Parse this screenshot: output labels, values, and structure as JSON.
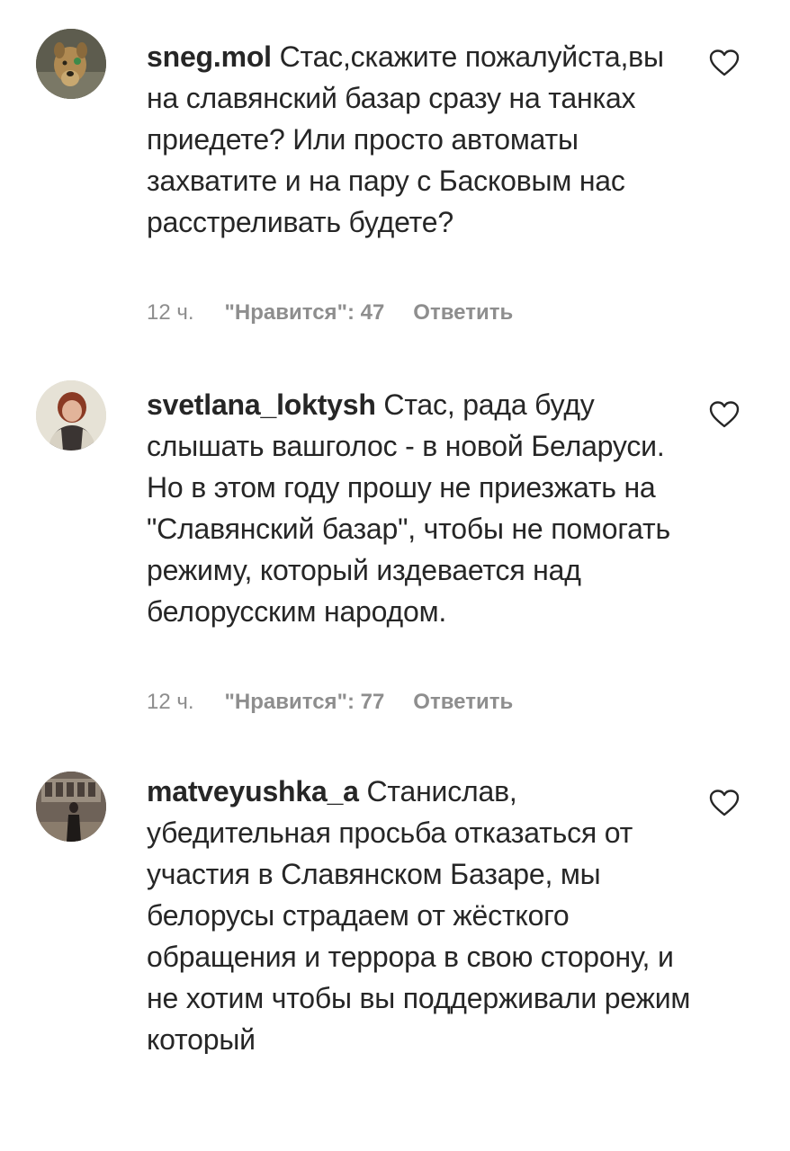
{
  "comments": [
    {
      "username": "sneg.mol",
      "text": "Стас,скажите пожалуйста,вы на славянский базар сразу на танках приедете? Или просто автоматы захватите и на пару с Басковым нас расстреливать будете?",
      "time": "12 ч.",
      "likes": "\"Нравится\": 47",
      "reply": "Ответить",
      "avatar_icon": "dog-photo-avatar"
    },
    {
      "username": "svetlana_loktysh",
      "text": "Стас, рада буду слышать вашголос - в новой Беларуси. Но в этом году прошу не приезжать на \"Славянский базар\", чтобы не помогать режиму, который издевается над белорусским народом.",
      "time": "12 ч.",
      "likes": "\"Нравится\": 77",
      "reply": "Ответить",
      "avatar_icon": "woman-photo-avatar"
    },
    {
      "username": "matveyushka_a",
      "text": "Станислав, убедительная просьба отказаться от участия в Славянском Базаре, мы белорусы страдаем от жёсткого обращения и террора в свою сторону, и не хотим чтобы вы поддерживали режим который",
      "avatar_icon": "person-photo-avatar"
    }
  ],
  "colors": {
    "text": "#262626",
    "meta": "#8e8e8e",
    "background": "#ffffff"
  }
}
